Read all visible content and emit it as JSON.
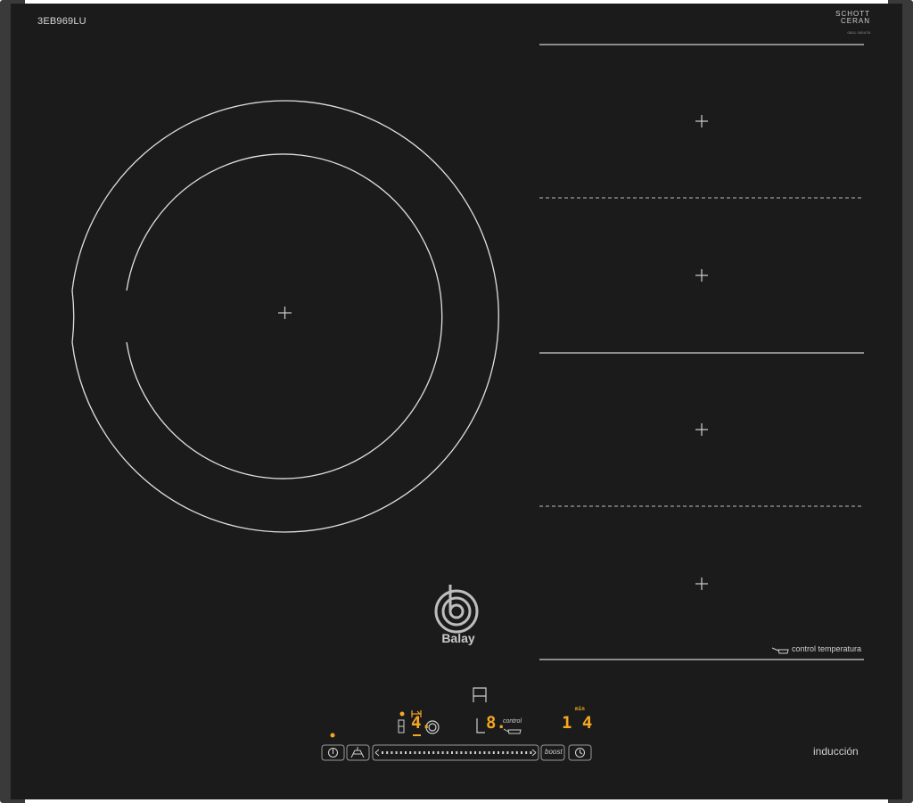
{
  "hob": {
    "model": "3EB969LU",
    "glass_brand_line1": "SCHOTT",
    "glass_brand_line2": "CERAN",
    "glass_code": "0001 000478",
    "brand_name": "Balay",
    "induction_label": "inducción",
    "control_temp_label": "control temperatura"
  },
  "controls": {
    "left_zone_level": "4.",
    "center_digits": "8.",
    "center_control_label": "control",
    "timer_unit": "min",
    "timer_value": "1 4",
    "boost_label": "boost"
  },
  "icons": {
    "power": "power-icon",
    "wipe": "wipe-protection-icon",
    "timer": "clock-icon",
    "pan": "pan-icon",
    "brand_logo": "balay-logo-icon"
  },
  "colors": {
    "glass": "#1b1b1b",
    "frame": "#3a3a3a",
    "line": "#d0d0d0",
    "display": "#f5a623"
  }
}
